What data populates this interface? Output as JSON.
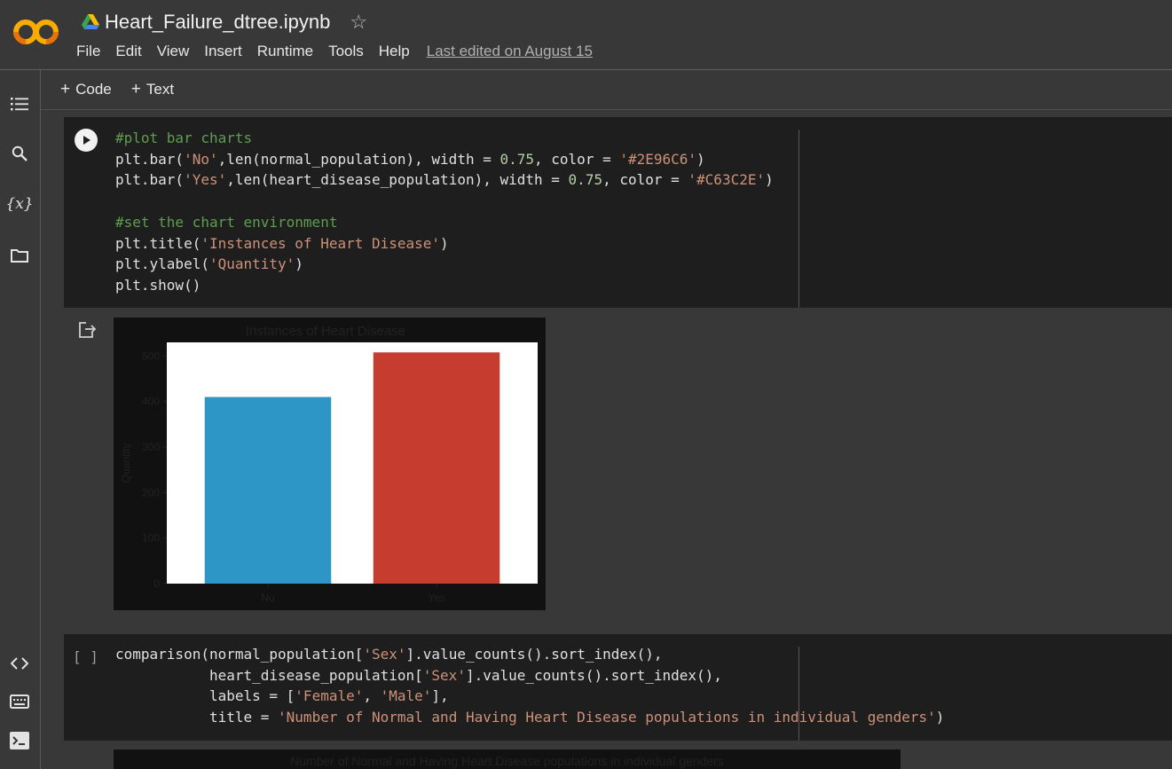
{
  "header": {
    "title": "Heart_Failure_dtree.ipynb",
    "menu": [
      "File",
      "Edit",
      "View",
      "Insert",
      "Runtime",
      "Tools",
      "Help"
    ],
    "last_edited": "Last edited on August 15"
  },
  "toolbar": {
    "code_label": "Code",
    "text_label": "Text"
  },
  "cell1": {
    "lines": [
      [
        [
          "cm",
          "#plot bar charts"
        ]
      ],
      [
        [
          "",
          "plt.bar("
        ],
        [
          "st",
          "'No'"
        ],
        [
          "",
          ",len(normal_population), width = "
        ],
        [
          "nu",
          "0.75"
        ],
        [
          "",
          ", color = "
        ],
        [
          "st",
          "'#2E96C6'"
        ],
        [
          "",
          ")"
        ]
      ],
      [
        [
          "",
          "plt.bar("
        ],
        [
          "st",
          "'Yes'"
        ],
        [
          "",
          ",len(heart_disease_population), width = "
        ],
        [
          "nu",
          "0.75"
        ],
        [
          "",
          ", color = "
        ],
        [
          "st",
          "'#C63C2E'"
        ],
        [
          "",
          ")"
        ]
      ],
      [
        [
          "",
          ""
        ]
      ],
      [
        [
          "cm",
          "#set the chart environment"
        ]
      ],
      [
        [
          "",
          "plt.title("
        ],
        [
          "st",
          "'Instances of Heart Disease'"
        ],
        [
          "",
          ")"
        ]
      ],
      [
        [
          "",
          "plt.ylabel("
        ],
        [
          "st",
          "'Quantity'"
        ],
        [
          "",
          ")"
        ]
      ],
      [
        [
          "",
          "plt.show()"
        ]
      ]
    ]
  },
  "cell2": {
    "bracket": "[ ]",
    "lines": [
      [
        [
          "",
          "comparison(normal_population["
        ],
        [
          "st",
          "'Sex'"
        ],
        [
          "",
          "].value_counts().sort_index(),"
        ]
      ],
      [
        [
          "",
          "           heart_disease_population["
        ],
        [
          "st",
          "'Sex'"
        ],
        [
          "",
          "].value_counts().sort_index(),"
        ]
      ],
      [
        [
          "",
          "           labels = ["
        ],
        [
          "st",
          "'Female'"
        ],
        [
          "",
          ", "
        ],
        [
          "st",
          "'Male'"
        ],
        [
          "",
          "],"
        ]
      ],
      [
        [
          "",
          "           title = "
        ],
        [
          "st",
          "'Number of Normal and Having Heart Disease populations in individual genders'"
        ],
        [
          "",
          ")"
        ]
      ]
    ]
  },
  "chart_data": {
    "type": "bar",
    "title": "Instances of Heart Disease",
    "ylabel": "Quantity",
    "xlabel": "",
    "categories": [
      "No",
      "Yes"
    ],
    "values": [
      410,
      508
    ],
    "colors": [
      "#2E96C6",
      "#C63C2E"
    ],
    "ylim": [
      0,
      530
    ],
    "yticks": [
      0,
      100,
      200,
      300,
      400,
      500
    ]
  },
  "plot2_title": "Number of Normal and Having Heart Disease populations in individual genders"
}
